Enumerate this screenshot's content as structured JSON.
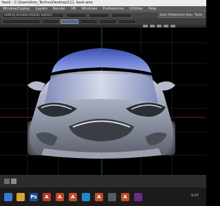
{
  "window": {
    "title_text": "!back : C:\\Users\\Ares_Techno\\Desktop\\111. back.wire"
  },
  "menu": {
    "items": [
      {
        "label": "WindowDisplay"
      },
      {
        "label": "Layers"
      },
      {
        "label": "Render"
      },
      {
        "label": "VR"
      },
      {
        "label": "Windows"
      },
      {
        "label": "Preferences"
      },
      {
        "label": "Utilities"
      },
      {
        "label": "Help"
      }
    ]
  },
  "toolbar": {
    "field_text": "Setting window display options",
    "pref_button_label": "User Preference Sets",
    "tool_label": "Tools"
  },
  "taskbar": {
    "icons": [
      {
        "name": "taskbar-app-explorer",
        "color": "#d9a33a",
        "glyph": ""
      },
      {
        "name": "taskbar-app-photoshop",
        "color": "#1c4fa0",
        "glyph": "Ps"
      },
      {
        "name": "taskbar-app-autodesk",
        "color": "#b23a2a",
        "glyph": "A"
      },
      {
        "name": "taskbar-app-autodesk-2",
        "color": "#c4462a",
        "glyph": "A"
      },
      {
        "name": "taskbar-app-alias",
        "color": "#c24b2a",
        "glyph": "A"
      },
      {
        "name": "taskbar-app-blue",
        "color": "#1e88c8",
        "glyph": ""
      },
      {
        "name": "taskbar-app-alias-2",
        "color": "#c24b2a",
        "glyph": "A"
      },
      {
        "name": "taskbar-app-vred",
        "color": "#5a5a5a",
        "glyph": ""
      },
      {
        "name": "taskbar-app-alias-3",
        "color": "#c24b2a",
        "glyph": "A"
      },
      {
        "name": "taskbar-app-purple",
        "color": "#6a2a8a",
        "glyph": ""
      }
    ],
    "tray_text": "9:07"
  }
}
